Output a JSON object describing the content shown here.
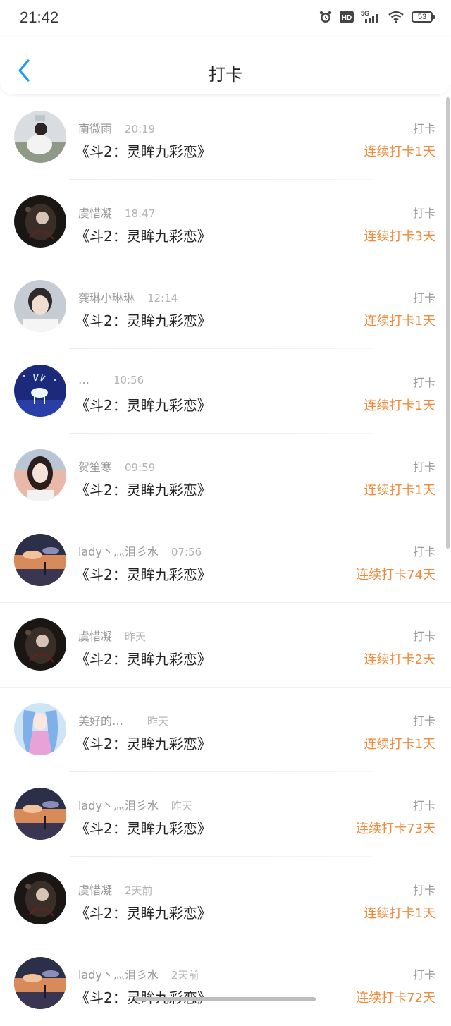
{
  "status": {
    "time": "21:42",
    "battery": "53",
    "network": "5G"
  },
  "header": {
    "title": "打卡"
  },
  "colors": {
    "accent": "#f08a3a",
    "back": "#1e9cf0"
  },
  "list": [
    {
      "name": "南微雨",
      "time": "20:19",
      "book": "《斗2：灵眸九彩恋》",
      "tag": "打卡",
      "streak": "连续打卡1天",
      "avatar": "avatar-girl-white-dress"
    },
    {
      "name": "虞惜凝",
      "time": "18:47",
      "book": "《斗2：灵眸九彩恋》",
      "tag": "打卡",
      "streak": "连续打卡3天",
      "avatar": "avatar-dark-anime"
    },
    {
      "name": "龚琳小琳琳",
      "time": "12:14",
      "book": "《斗2：灵眸九彩恋》",
      "tag": "打卡",
      "streak": "连续打卡1天",
      "avatar": "avatar-boy-portrait"
    },
    {
      "name": "…",
      "time": "10:56",
      "book": "《斗2：灵眸九彩恋》",
      "tag": "打卡",
      "streak": "连续打卡1天",
      "avatar": "avatar-glowing-deer"
    },
    {
      "name": "贺笙寒",
      "time": "09:59",
      "book": "《斗2：灵眸九彩恋》",
      "tag": "打卡",
      "streak": "连续打卡1天",
      "avatar": "avatar-girl-sunset"
    },
    {
      "name": "lady丶灬泪彡水",
      "time": "07:56",
      "book": "《斗2：灵眸九彩恋》",
      "tag": "打卡",
      "streak": "连续打卡74天",
      "avatar": "avatar-sunset-sky"
    },
    {
      "name": "虞惜凝",
      "time": "昨天",
      "book": "《斗2：灵眸九彩恋》",
      "tag": "打卡",
      "streak": "连续打卡2天",
      "avatar": "avatar-dark-anime"
    },
    {
      "name": "美好的…",
      "time": "昨天",
      "book": "《斗2：灵眸九彩恋》",
      "tag": "打卡",
      "streak": "连续打卡1天",
      "avatar": "avatar-anime-blue-hair"
    },
    {
      "name": "lady丶灬泪彡水",
      "time": "昨天",
      "book": "《斗2：灵眸九彩恋》",
      "tag": "打卡",
      "streak": "连续打卡73天",
      "avatar": "avatar-sunset-sky"
    },
    {
      "name": "虞惜凝",
      "time": "2天前",
      "book": "《斗2：灵眸九彩恋》",
      "tag": "打卡",
      "streak": "连续打卡1天",
      "avatar": "avatar-dark-anime"
    },
    {
      "name": "lady丶灬泪彡水",
      "time": "2天前",
      "book": "《斗2：灵眸九彩恋》",
      "tag": "打卡",
      "streak": "连续打卡72天",
      "avatar": "avatar-sunset-sky"
    }
  ]
}
